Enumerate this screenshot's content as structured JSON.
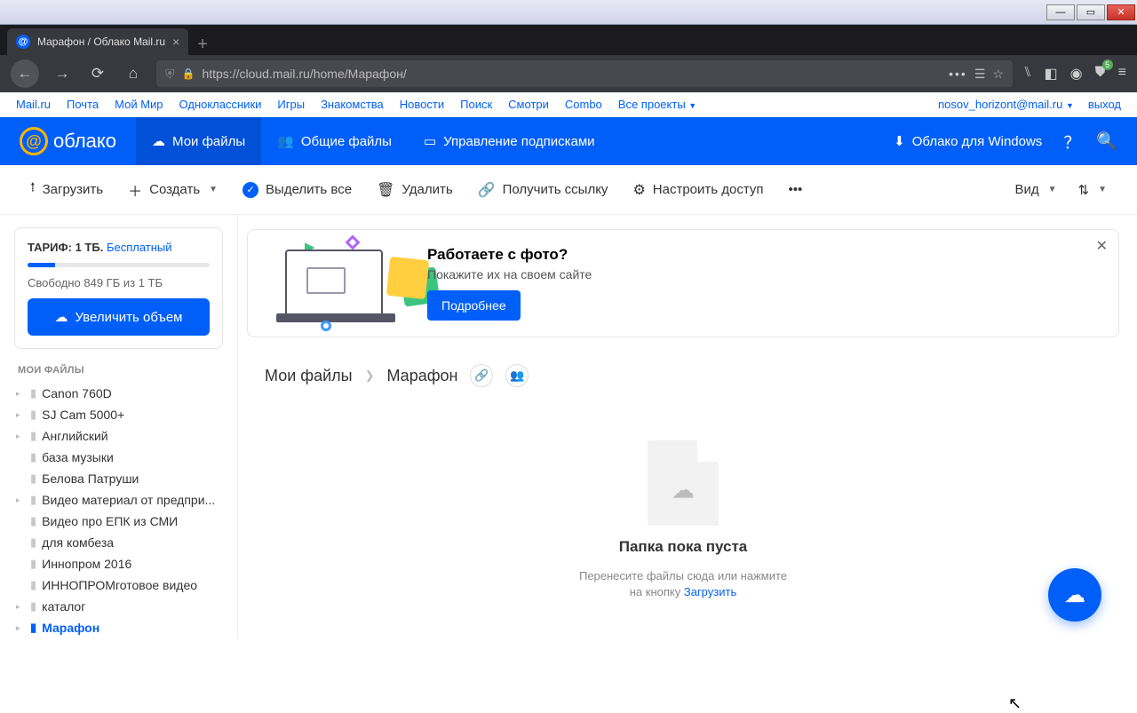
{
  "window": {
    "tab_title": "Марафон / Облако Mail.ru"
  },
  "url": {
    "address": "https://cloud.mail.ru/home/Марафон/"
  },
  "topnav": {
    "links": [
      "Mail.ru",
      "Почта",
      "Мой Мир",
      "Одноклассники",
      "Игры",
      "Знакомства",
      "Новости",
      "Поиск",
      "Смотри",
      "Combo",
      "Все проекты"
    ],
    "user": "nosov_horizont@mail.ru",
    "logout": "выход"
  },
  "header": {
    "brand": "облако",
    "tabs": {
      "my_files": "Мои файлы",
      "shared": "Общие файлы",
      "subs": "Управление подписками"
    },
    "win_app": "Облако для Windows"
  },
  "toolbar": {
    "upload": "Загрузить",
    "create": "Создать",
    "select_all": "Выделить все",
    "delete": "Удалить",
    "get_link": "Получить ссылку",
    "access": "Настроить доступ",
    "view": "Вид"
  },
  "tariff": {
    "label": "ТАРИФ:",
    "size": "1 ТБ.",
    "plan": "Бесплатный",
    "free_text": "Свободно 849 ГБ из 1 ТБ",
    "upgrade": "Увеличить объем"
  },
  "sidebar": {
    "heading": "МОИ ФАЙЛЫ",
    "items": [
      {
        "label": "Canon 760D",
        "exp": true
      },
      {
        "label": "SJ Cam 5000+",
        "exp": true
      },
      {
        "label": "Английский",
        "exp": true
      },
      {
        "label": "база музыки",
        "exp": false
      },
      {
        "label": "Белова Патруши",
        "exp": false
      },
      {
        "label": "Видео материал от предпри...",
        "exp": true
      },
      {
        "label": "Видео про ЕПК из СМИ",
        "exp": false
      },
      {
        "label": "для комбеза",
        "exp": false
      },
      {
        "label": "Иннопром 2016",
        "exp": false
      },
      {
        "label": "ИННОПРОМготовое видео",
        "exp": false
      },
      {
        "label": "каталог",
        "exp": true
      },
      {
        "label": "Марафон",
        "exp": true,
        "selected": true
      }
    ]
  },
  "promo": {
    "title": "Работаете с фото?",
    "subtitle": "Покажите их на своем сайте",
    "cta": "Подробнее"
  },
  "breadcrumb": {
    "root": "Мои файлы",
    "current": "Марафон"
  },
  "empty": {
    "title": "Папка пока пуста",
    "line1": "Перенесите файлы сюда или нажмите",
    "line2_prefix": "на кнопку ",
    "link": "Загрузить"
  }
}
